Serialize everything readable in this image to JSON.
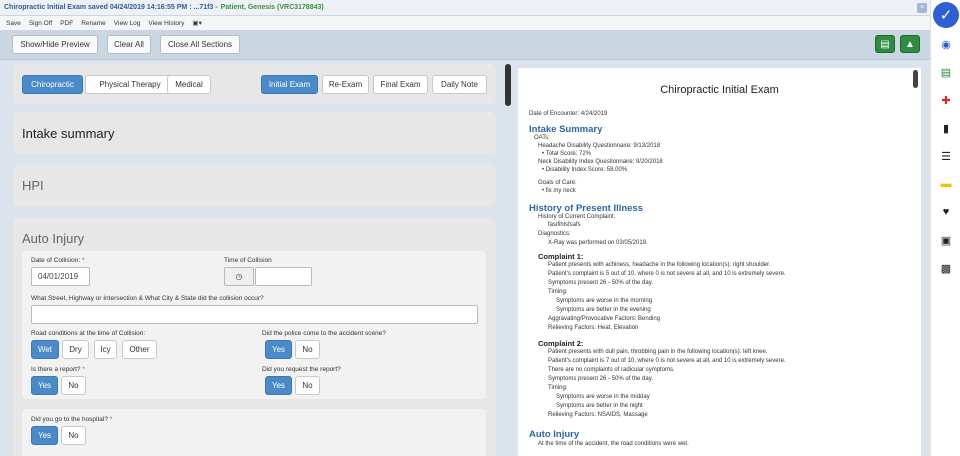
{
  "window": {
    "title": "Chiropractic Initial Exam saved 04/24/2019 14:16:55 PM : ...71f3 -",
    "patient": "Patient, Genesis (VRC3178843)",
    "close": "×"
  },
  "menu": [
    "Save",
    "Sign Off",
    "PDF",
    "Rename",
    "View Log",
    "View History"
  ],
  "toolbar": {
    "show_hide": "Show/Hide Preview",
    "clear_all": "Clear All",
    "close_sections": "Close All Sections"
  },
  "specialty_tabs": [
    "Chiropractic",
    "Physical Therapy",
    "Medical"
  ],
  "exam_tabs": [
    "Initial Exam",
    "Re-Exam",
    "Final Exam",
    "Daily Note"
  ],
  "sections": {
    "intake": "Intake summary",
    "hpi": "HPI",
    "auto": "Auto Injury"
  },
  "form": {
    "date_label": "Date of Collision:",
    "date_value": "04/01/2019",
    "time_label": "Time of Collision",
    "street_label": "What Street, Highway or Intersection & What City & State did the collision occur?",
    "road_label": "Road conditions at the time of Collision:",
    "road_opts": [
      "Wet",
      "Dry",
      "Icy",
      "Other"
    ],
    "police_label": "Did the police come to the accident scene?",
    "report_label": "Is there a report?",
    "request_label": "Did you request the report?",
    "hospital_label": "Did you go to the hospital?",
    "yes": "Yes",
    "no": "No",
    "req": "*"
  },
  "preview": {
    "title": "Chiropractic Initial Exam",
    "encounter_label": "Date of Encounter:",
    "encounter_value": "4/24/2019",
    "intake_title": "Intake Summary",
    "oats": "OATs:",
    "hdq": "Headache Disability Questionnaire: 9/13/2018",
    "hdq_score": "• Total Score: 72%",
    "ndi": "Neck Disability Index Questionnaire: 9/20/2018",
    "ndi_score": "• Disability Index Score: 58.00%",
    "goals": "Goals of Care:",
    "goal1": "• fix my neck",
    "hpi_title": "History of Present Illness",
    "hcc": "History of Current Complaint:",
    "hcc_val": "fasifihlsfsafs",
    "diag": "Diagnostics:",
    "diag_val": "X-Ray was performed on 03/05/2019.",
    "c1_title": "Complaint 1:",
    "c1": [
      "Patient presents with achiness, headache in the following location(s): right shoulder.",
      "Patient's complaint is 5 out of 10, where 0 is not severe at all, and 10 is extremely severe.",
      "Symptoms present 26 - 50% of the day.",
      "Timing:",
      "Symptoms are worse in the morning",
      "Symptoms are better in the evening",
      "Aggravating/Provocative Factors: Bending",
      "Relieving Factors: Heat, Elevation"
    ],
    "c2_title": "Complaint 2:",
    "c2": [
      "Patient presents with dull pain, throbbing pain in the following location(s): left knee.",
      "Patient's complaint is 7 out of 10, where 0 is not severe at all, and 10 is extremely severe.",
      "There are no complaints of radicular symptoms.",
      "Symptoms present 26 - 50% of the day.",
      "Timing:",
      "Symptoms are worse in the midday",
      "Symptoms are better in the night",
      "Relieving Factors: NSAIDS, Massage"
    ],
    "auto_title": "Auto Injury",
    "auto_line": "At the time of the accident, the road conditions were wet."
  },
  "colors": {
    "accent": "#4a8ac9",
    "green": "#2e8b3f",
    "section_blue": "#2a67a8"
  }
}
